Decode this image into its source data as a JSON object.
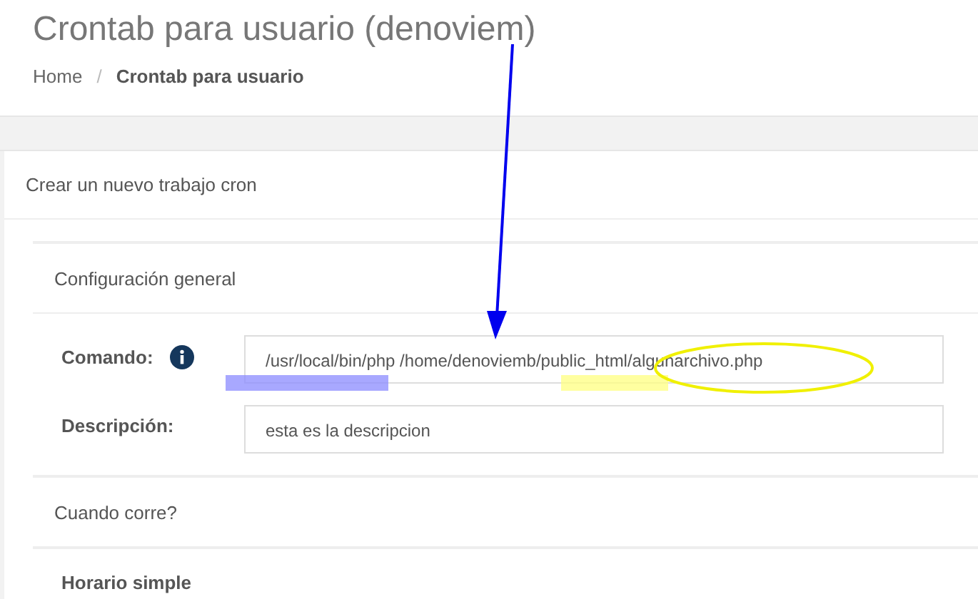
{
  "page_title": "Crontab para usuario (denoviem)",
  "breadcrumb": [
    {
      "label": "Home",
      "current": false
    },
    {
      "label": "Crontab para usuario",
      "current": true
    }
  ],
  "breadcrumb_separator": "/",
  "card_title": "Crear un nuevo trabajo cron",
  "sections": [
    {
      "heading": "Configuración general",
      "fields": [
        {
          "label": "Comando:",
          "info": true,
          "value": "/usr/local/bin/php /home/denoviemb/public_html/algunarchivo.php"
        },
        {
          "label": "Descripción:",
          "info": false,
          "value": "esta es la descripcion"
        }
      ]
    },
    {
      "heading": "Cuando corre?"
    }
  ],
  "subheading": "Horario simple"
}
